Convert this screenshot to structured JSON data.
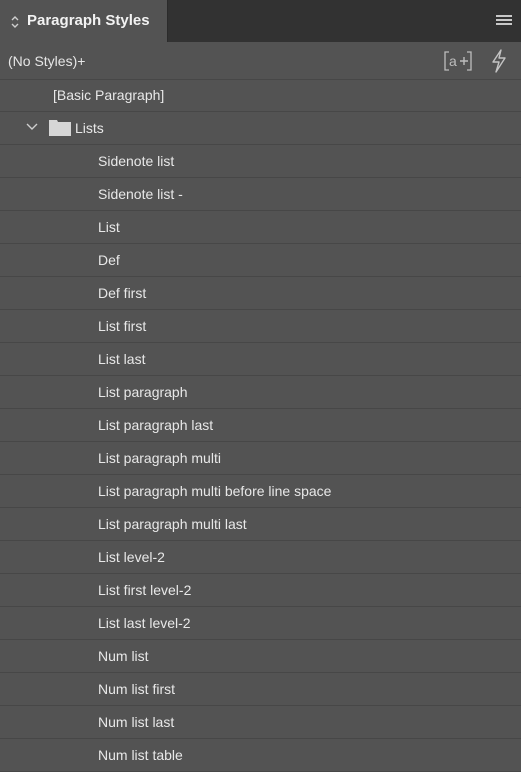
{
  "panel": {
    "title": "Paragraph Styles",
    "toggle_icon": "collapse-expand-icon",
    "menu_icon": "panel-menu-icon"
  },
  "toolbar": {
    "current_style": "(No Styles)+",
    "new_style_icon_text": "[a+]",
    "quick_apply_icon": "lightning-icon"
  },
  "styles": {
    "basic": "[Basic Paragraph]",
    "group": {
      "name": "Lists",
      "expanded": true,
      "items": [
        "Sidenote list",
        "Sidenote list -",
        "List",
        "Def",
        "Def first",
        "List first",
        "List last",
        "List paragraph",
        "List paragraph last",
        "List paragraph multi",
        "List paragraph multi before line space",
        "List paragraph multi last",
        "List level-2",
        "List first level-2",
        "List last level-2",
        "Num list",
        "Num list first",
        "Num list last",
        "Num list table"
      ]
    }
  },
  "colors": {
    "panel_bg": "#535353",
    "tabbar_bg": "#323232",
    "divider": "#474747",
    "text": "#e8e8e8"
  }
}
